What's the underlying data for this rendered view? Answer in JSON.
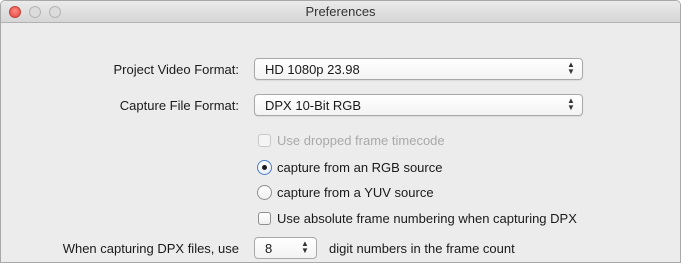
{
  "window": {
    "title": "Preferences"
  },
  "form": {
    "project_video_format": {
      "label": "Project Video Format:",
      "value": "HD 1080p 23.98"
    },
    "capture_file_format": {
      "label": "Capture File Format:",
      "value": "DPX 10-Bit RGB"
    },
    "use_dropped_frame_timecode": {
      "label": "Use dropped frame timecode",
      "checked": false,
      "enabled": false
    },
    "capture_source": {
      "options": [
        {
          "label": "capture from an RGB source",
          "selected": true
        },
        {
          "label": "capture from a YUV source",
          "selected": false
        }
      ]
    },
    "use_absolute_frame_numbering": {
      "label": "Use absolute frame numbering when capturing DPX",
      "checked": false
    },
    "dpx_digits": {
      "prefix_label": "When capturing DPX files, use",
      "value": "8",
      "suffix_label": "digit numbers in the frame count"
    }
  },
  "icons": {
    "close": "close-icon",
    "minimize": "minimize-icon",
    "maximize": "maximize-icon",
    "popup_arrows": "up-down-arrows-icon"
  }
}
